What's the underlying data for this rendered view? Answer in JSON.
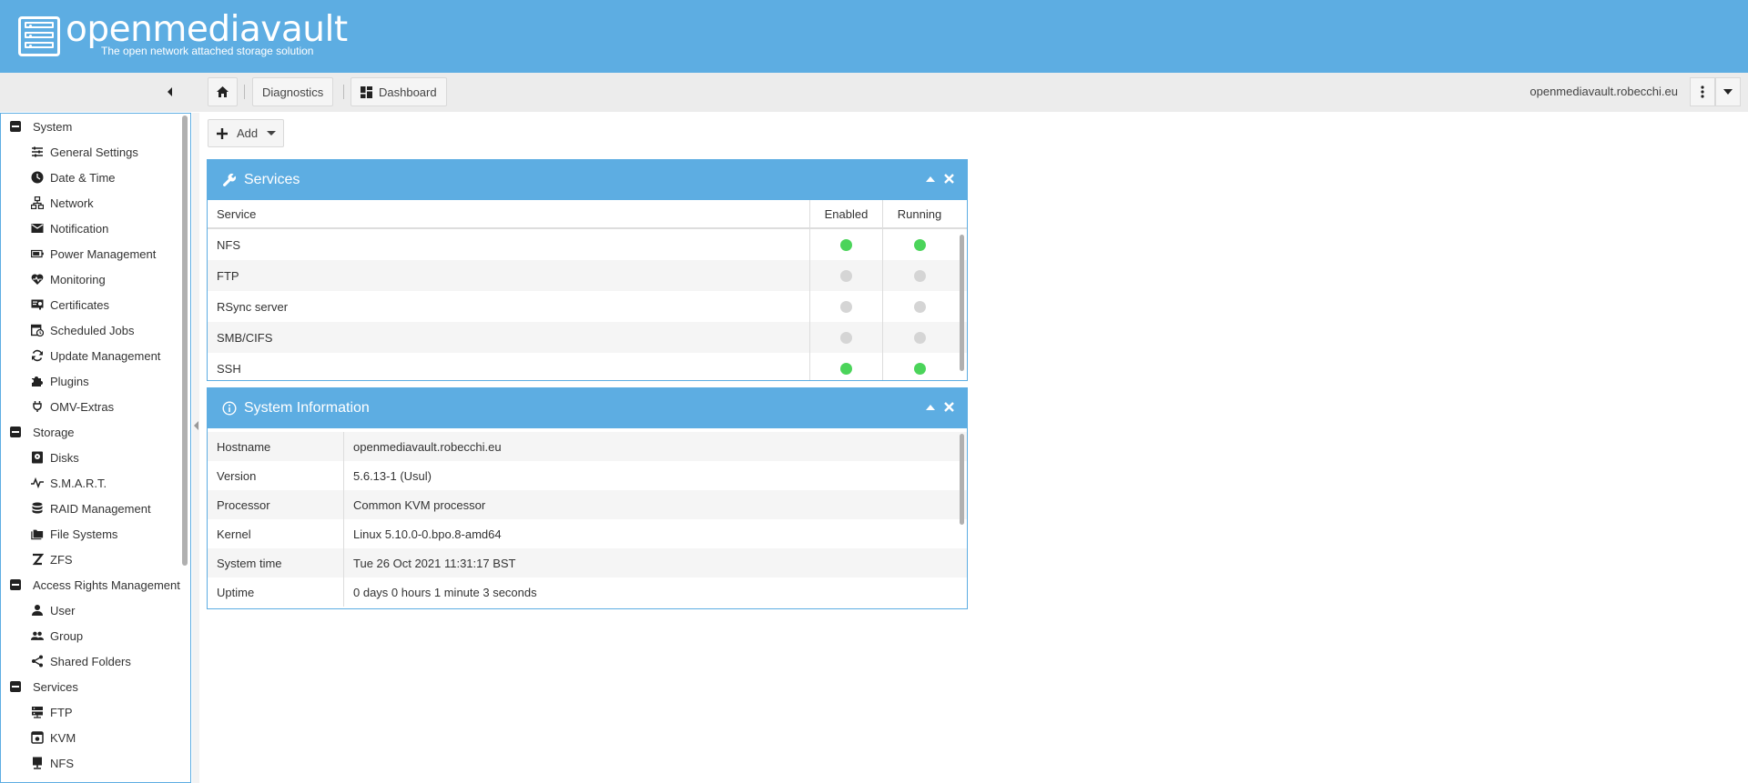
{
  "header": {
    "title": "openmediavault",
    "subtitle": "The open network attached storage solution",
    "brand_color": "#5dade2"
  },
  "toolbar": {
    "breadcrumb_home_icon": "home-icon",
    "breadcrumb_items": [
      {
        "label": "Diagnostics"
      },
      {
        "label": "Dashboard",
        "icon": "dashboard-icon"
      }
    ],
    "hostname": "openmediavault.robecchi.eu"
  },
  "sidebar": {
    "groups": [
      {
        "label": "System",
        "items": [
          {
            "label": "General Settings",
            "icon": "sliders-icon"
          },
          {
            "label": "Date & Time",
            "icon": "clock-icon"
          },
          {
            "label": "Network",
            "icon": "network-icon"
          },
          {
            "label": "Notification",
            "icon": "mail-icon"
          },
          {
            "label": "Power Management",
            "icon": "battery-icon"
          },
          {
            "label": "Monitoring",
            "icon": "heart-pulse-icon"
          },
          {
            "label": "Certificates",
            "icon": "certificate-icon"
          },
          {
            "label": "Scheduled Jobs",
            "icon": "calendar-clock-icon"
          },
          {
            "label": "Update Management",
            "icon": "refresh-icon"
          },
          {
            "label": "Plugins",
            "icon": "puzzle-icon"
          },
          {
            "label": "OMV-Extras",
            "icon": "plug-icon"
          }
        ]
      },
      {
        "label": "Storage",
        "items": [
          {
            "label": "Disks",
            "icon": "disk-icon"
          },
          {
            "label": "S.M.A.R.T.",
            "icon": "pulse-icon"
          },
          {
            "label": "RAID Management",
            "icon": "database-icon"
          },
          {
            "label": "File Systems",
            "icon": "folders-icon"
          },
          {
            "label": "ZFS",
            "icon": "zfs-icon"
          }
        ]
      },
      {
        "label": "Access Rights Management",
        "items": [
          {
            "label": "User",
            "icon": "user-icon"
          },
          {
            "label": "Group",
            "icon": "group-icon"
          },
          {
            "label": "Shared Folders",
            "icon": "share-icon"
          }
        ]
      },
      {
        "label": "Services",
        "items": [
          {
            "label": "FTP",
            "icon": "server-icon"
          },
          {
            "label": "KVM",
            "icon": "kvm-icon"
          },
          {
            "label": "NFS",
            "icon": "monitor-icon"
          }
        ]
      }
    ]
  },
  "main": {
    "add_label": "Add",
    "services_panel": {
      "title": "Services",
      "columns": [
        "Service",
        "Enabled",
        "Running"
      ],
      "rows": [
        {
          "service": "NFS",
          "enabled": true,
          "running": true
        },
        {
          "service": "FTP",
          "enabled": false,
          "running": false
        },
        {
          "service": "RSync server",
          "enabled": false,
          "running": false
        },
        {
          "service": "SMB/CIFS",
          "enabled": false,
          "running": false
        },
        {
          "service": "SSH",
          "enabled": true,
          "running": true
        }
      ],
      "status_on_color": "#4bd45a",
      "status_off_color": "#d5d5d5"
    },
    "sysinfo_panel": {
      "title": "System Information",
      "rows": [
        {
          "key": "Hostname",
          "value": "openmediavault.robecchi.eu"
        },
        {
          "key": "Version",
          "value": "5.6.13-1 (Usul)"
        },
        {
          "key": "Processor",
          "value": "Common KVM processor"
        },
        {
          "key": "Kernel",
          "value": "Linux 5.10.0-0.bpo.8-amd64"
        },
        {
          "key": "System time",
          "value": "Tue 26 Oct 2021 11:31:17 BST"
        },
        {
          "key": "Uptime",
          "value": "0 days 0 hours 1 minute 3 seconds"
        }
      ]
    }
  }
}
